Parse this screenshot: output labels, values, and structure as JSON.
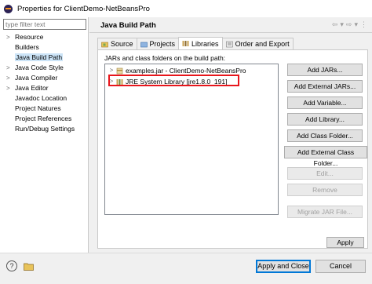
{
  "window": {
    "title": "Properties for ClientDemo-NetBeansPro"
  },
  "sidebar": {
    "filter_placeholder": "type filter text",
    "items": [
      {
        "label": "Resource",
        "expandable": true
      },
      {
        "label": "Builders",
        "expandable": false
      },
      {
        "label": "Java Build Path",
        "expandable": false,
        "selected": true
      },
      {
        "label": "Java Code Style",
        "expandable": true
      },
      {
        "label": "Java Compiler",
        "expandable": true
      },
      {
        "label": "Java Editor",
        "expandable": true
      },
      {
        "label": "Javadoc Location",
        "expandable": false
      },
      {
        "label": "Project Natures",
        "expandable": false
      },
      {
        "label": "Project References",
        "expandable": false
      },
      {
        "label": "Run/Debug Settings",
        "expandable": false
      }
    ]
  },
  "page": {
    "title": "Java Build Path",
    "tabs": [
      {
        "label": "Source",
        "icon": "source-folder-icon"
      },
      {
        "label": "Projects",
        "icon": "projects-icon"
      },
      {
        "label": "Libraries",
        "icon": "libraries-icon",
        "active": true
      },
      {
        "label": "Order and Export",
        "icon": "order-export-icon"
      }
    ],
    "subtitle": "JARs and class folders on the build path:",
    "entries": [
      {
        "label": "examples.jar - ClientDemo-NetBeansPro",
        "icon": "jar-icon"
      },
      {
        "label": "JRE System Library [jre1.8.0_191]",
        "icon": "library-icon"
      }
    ],
    "buttons": {
      "add_jars": "Add JARs...",
      "add_external_jars": "Add External JARs...",
      "add_variable": "Add Variable...",
      "add_library": "Add Library...",
      "add_class_folder": "Add Class Folder...",
      "add_external_class_folder": "Add External Class Folder...",
      "edit": "Edit...",
      "remove": "Remove",
      "migrate_jar": "Migrate JAR File..."
    },
    "apply": "Apply"
  },
  "footer": {
    "apply_close": "Apply and Close",
    "cancel": "Cancel"
  },
  "colors": {
    "highlight_box": "#e8161c",
    "selection": "#cce4f7",
    "primary_border": "#0078d7"
  }
}
